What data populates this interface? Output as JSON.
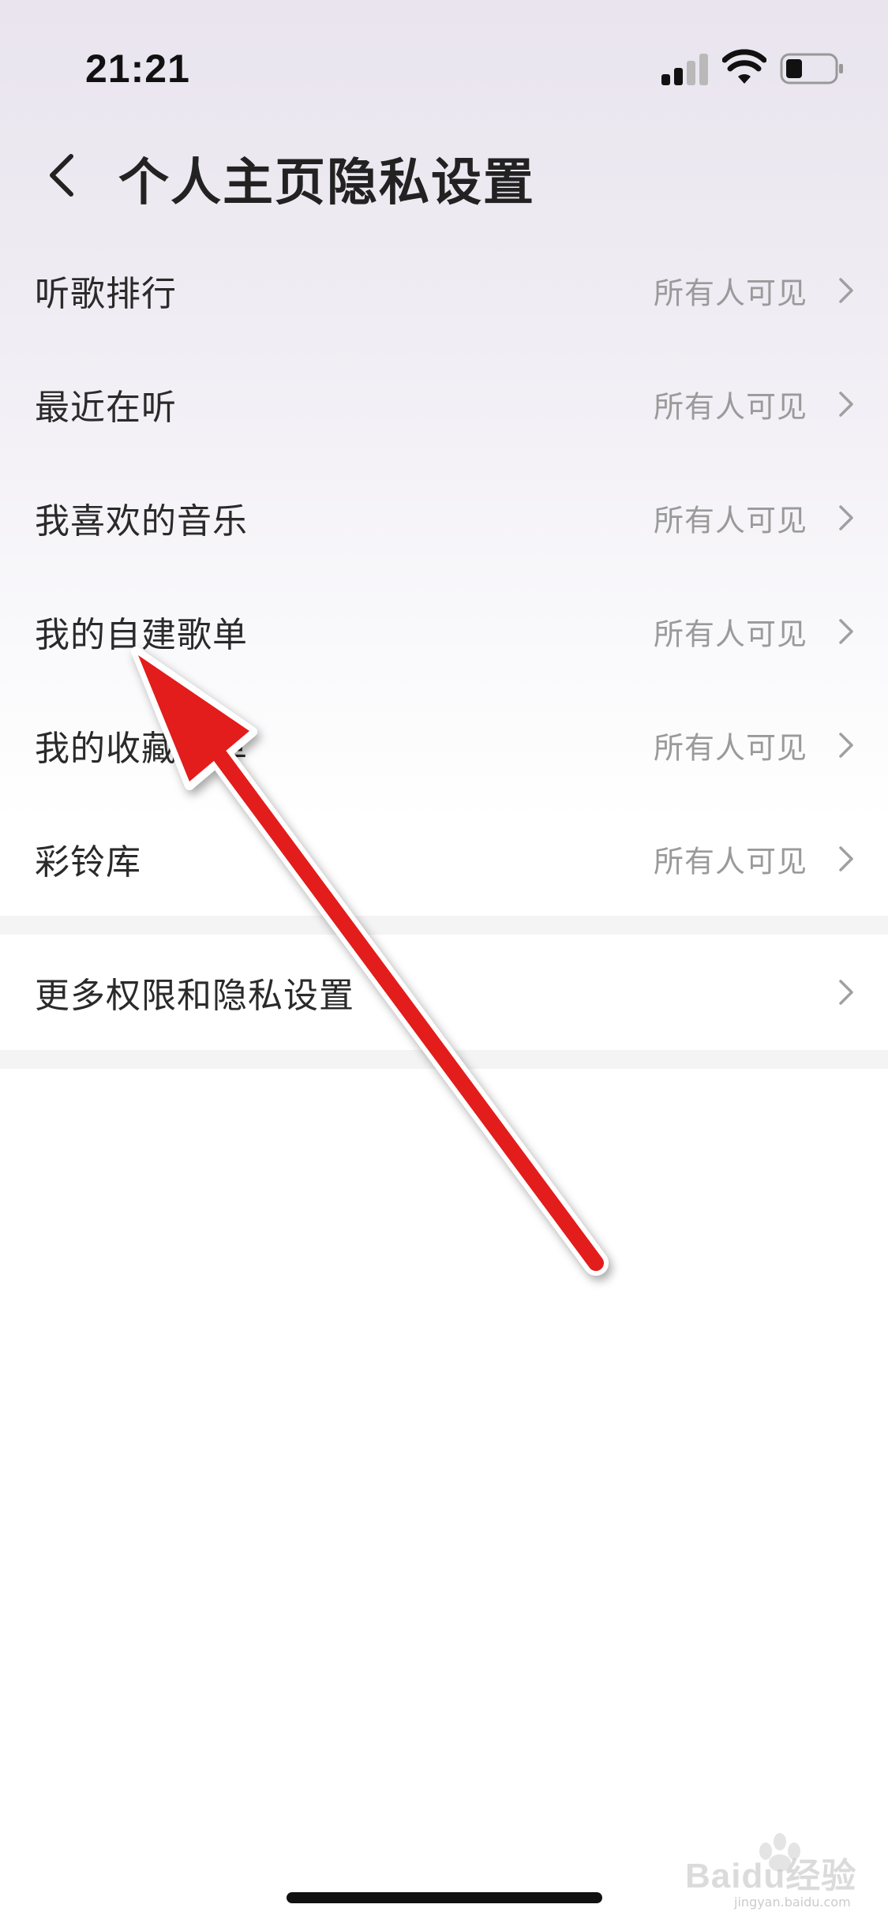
{
  "status_bar": {
    "time": "21:21",
    "icons": [
      "signal-icon",
      "wifi-icon",
      "battery-icon"
    ]
  },
  "header": {
    "back_icon": "chevron-left-icon",
    "title": "个人主页隐私设置"
  },
  "settings": {
    "items": [
      {
        "label": "听歌排行",
        "value": "所有人可见"
      },
      {
        "label": "最近在听",
        "value": "所有人可见"
      },
      {
        "label": "我喜欢的音乐",
        "value": "所有人可见"
      },
      {
        "label": "我的自建歌单",
        "value": "所有人可见"
      },
      {
        "label": "我的收藏歌单",
        "value": "所有人可见"
      },
      {
        "label": "彩铃库",
        "value": "所有人可见"
      }
    ],
    "more": {
      "label": "更多权限和隐私设置"
    }
  },
  "annotation": {
    "color": "#e31b1b"
  },
  "watermark": {
    "text": "Baidu经验",
    "sub": "jingyan.baidu.com"
  },
  "colors": {
    "label": "#2a2a2a",
    "value": "#9a9a9a",
    "arrow": "#e31b1b"
  }
}
